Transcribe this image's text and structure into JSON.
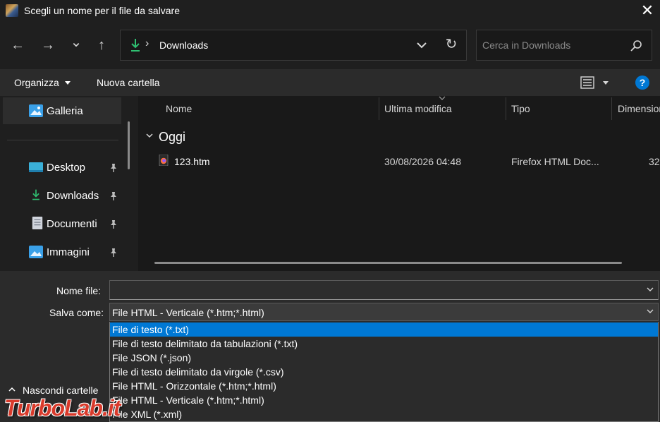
{
  "window": {
    "title": "Scegli un nome per il file da salvare",
    "close_glyph": "✕"
  },
  "nav": {
    "back_glyph": "←",
    "forward_glyph": "→",
    "recent_glyph": "⌄",
    "up_glyph": "↑",
    "breadcrumb_sep": "›",
    "location": "Downloads",
    "refresh_glyph": "↻",
    "search_placeholder": "Cerca in Downloads"
  },
  "toolbar": {
    "organize_label": "Organizza",
    "new_folder_label": "Nuova cartella",
    "help_glyph": "?"
  },
  "sidebar": {
    "items": [
      {
        "label": "Galleria",
        "icon": "gallery-icon",
        "pinned": false
      },
      {
        "label": "Desktop",
        "icon": "desktop-icon",
        "pinned": true
      },
      {
        "label": "Downloads",
        "icon": "download-icon",
        "pinned": true
      },
      {
        "label": "Documenti",
        "icon": "document-icon",
        "pinned": true
      },
      {
        "label": "Immagini",
        "icon": "images-icon",
        "pinned": true
      }
    ]
  },
  "filelist": {
    "columns": [
      "Nome",
      "Ultima modifica",
      "Tipo",
      "Dimensione"
    ],
    "group_label": "Oggi",
    "files": [
      {
        "name": "123.htm",
        "modified": "30/08/2026 04:48",
        "type": "Firefox HTML Doc...",
        "size": "32"
      }
    ]
  },
  "form": {
    "filename_label": "Nome file:",
    "filename_value": "",
    "saveas_label": "Salva come:",
    "saveas_value": "File HTML - Verticale (*.htm;*.html)",
    "saveas_options": [
      "File di testo (*.txt)",
      "File di testo delimitato da tabulazioni (*.txt)",
      "File JSON (*.json)",
      "File di testo delimitato da virgole (*.csv)",
      "File HTML - Orizzontale (*.htm;*.html)",
      "File HTML - Verticale (*.htm;*.html)",
      "File XML (*.xml)"
    ],
    "selected_option_index": 0,
    "hide_folders_label": "Nascondi cartelle"
  },
  "watermark": {
    "text": "TurboLab.it"
  },
  "colors": {
    "accent": "#0078d4",
    "download_green": "#2fbf71",
    "background": "#1f1f1f",
    "panel": "#2b2b2b"
  }
}
